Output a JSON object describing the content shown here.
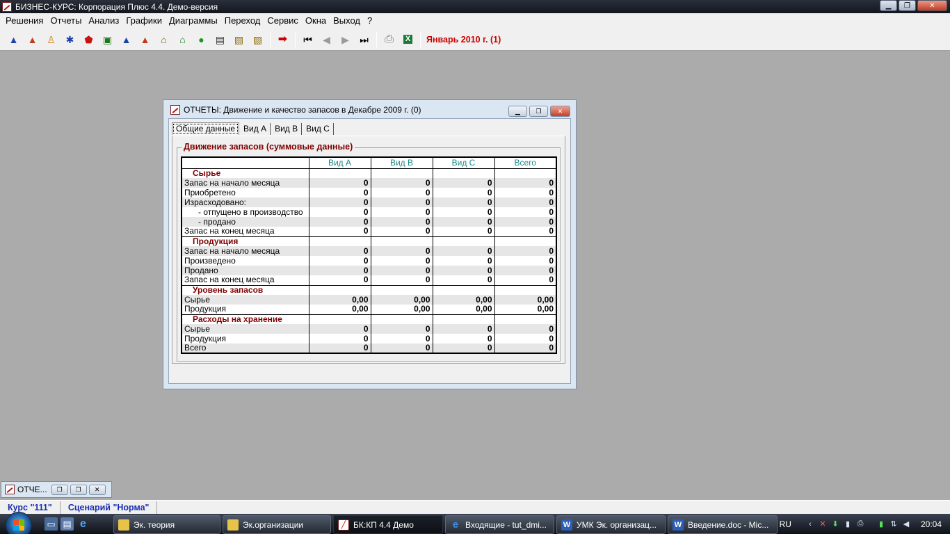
{
  "app": {
    "title": "БИЗНЕС-КУРС: Корпорация Плюс 4.4. Демо-версия",
    "minimize": "▁",
    "restore": "❐",
    "close": "✕"
  },
  "menu": [
    "Решения",
    "Отчеты",
    "Анализ",
    "Графики",
    "Диаграммы",
    "Переход",
    "Сервис",
    "Окна",
    "Выход",
    "?"
  ],
  "toolbar": {
    "icons_left": [
      {
        "name": "plan-icon",
        "glyph": "▲",
        "color": "#1c3fa8"
      },
      {
        "name": "marketing-icon",
        "glyph": "▲",
        "color": "#c23a1a"
      },
      {
        "name": "personnel-icon",
        "glyph": "♙",
        "color": "#d07a00"
      },
      {
        "name": "staff-icon",
        "glyph": "✱",
        "color": "#1c3fa8"
      },
      {
        "name": "production-icon",
        "glyph": "⬟",
        "color": "#cc1111"
      },
      {
        "name": "supply-icon",
        "glyph": "▣",
        "color": "#1a7a1a"
      },
      {
        "name": "sales-icon",
        "glyph": "▲",
        "color": "#1c3fa8"
      },
      {
        "name": "finance-icon",
        "glyph": "▲",
        "color": "#c23a1a"
      },
      {
        "name": "bank-icon",
        "glyph": "⌂",
        "color": "#7a5a10"
      },
      {
        "name": "credit-icon",
        "glyph": "⌂",
        "color": "#1a7a1a"
      },
      {
        "name": "money-bag-icon",
        "glyph": "●",
        "color": "#1a9a1a"
      },
      {
        "name": "document-icon",
        "glyph": "▤",
        "color": "#333333"
      },
      {
        "name": "report-icon",
        "glyph": "▧",
        "color": "#8a6a10"
      },
      {
        "name": "journal-icon",
        "glyph": "▨",
        "color": "#8a6a10"
      }
    ],
    "next_step": {
      "name": "next-step-icon",
      "glyph": "➡",
      "color": "#cc0000"
    },
    "nav": [
      {
        "name": "first-period-icon",
        "glyph": "⏮",
        "disabled": false
      },
      {
        "name": "prev-period-icon",
        "glyph": "◀",
        "disabled": true
      },
      {
        "name": "next-period-icon",
        "glyph": "▶",
        "disabled": true
      },
      {
        "name": "last-period-icon",
        "glyph": "⏭",
        "disabled": false
      }
    ],
    "print": {
      "name": "print-icon",
      "glyph": "⎙"
    },
    "excel": {
      "name": "excel-icon",
      "glyph": "X"
    },
    "period": "Январь 2010 г. (1)"
  },
  "report": {
    "title": "ОТЧЕТЫ: Движение и качество запасов в Декабре 2009 г. (0)",
    "tabs": [
      "Общие данные",
      "Вид А",
      "Вид В",
      "Вид С"
    ],
    "group_title": "Движение запасов (суммовые данные)",
    "columns": [
      "Вид А",
      "Вид В",
      "Вид С",
      "Всего"
    ],
    "sections": [
      {
        "title": "Сырье",
        "rows": [
          {
            "label": "Запас на начало месяца",
            "indent": false,
            "values": [
              "0",
              "0",
              "0",
              "0"
            ]
          },
          {
            "label": "Приобретено",
            "indent": false,
            "values": [
              "0",
              "0",
              "0",
              "0"
            ]
          },
          {
            "label": "Израсходовано:",
            "indent": false,
            "values": [
              "0",
              "0",
              "0",
              "0"
            ]
          },
          {
            "label": "- отпущено в производство",
            "indent": true,
            "values": [
              "0",
              "0",
              "0",
              "0"
            ]
          },
          {
            "label": "- продано",
            "indent": true,
            "values": [
              "0",
              "0",
              "0",
              "0"
            ]
          },
          {
            "label": "Запас на конец месяца",
            "indent": false,
            "values": [
              "0",
              "0",
              "0",
              "0"
            ]
          }
        ]
      },
      {
        "title": "Продукция",
        "rows": [
          {
            "label": "Запас на начало месяца",
            "indent": false,
            "values": [
              "0",
              "0",
              "0",
              "0"
            ]
          },
          {
            "label": "Произведено",
            "indent": false,
            "values": [
              "0",
              "0",
              "0",
              "0"
            ]
          },
          {
            "label": "Продано",
            "indent": false,
            "values": [
              "0",
              "0",
              "0",
              "0"
            ]
          },
          {
            "label": "Запас на конец месяца",
            "indent": false,
            "values": [
              "0",
              "0",
              "0",
              "0"
            ]
          }
        ]
      },
      {
        "title": "Уровень запасов",
        "rows": [
          {
            "label": "Сырье",
            "indent": false,
            "values": [
              "0,00",
              "0,00",
              "0,00",
              "0,00"
            ]
          },
          {
            "label": "Продукция",
            "indent": false,
            "values": [
              "0,00",
              "0,00",
              "0,00",
              "0,00"
            ]
          }
        ]
      },
      {
        "title": "Расходы на хранение",
        "rows": [
          {
            "label": "Сырье",
            "indent": false,
            "values": [
              "0",
              "0",
              "0",
              "0"
            ]
          },
          {
            "label": "Продукция",
            "indent": false,
            "values": [
              "0",
              "0",
              "0",
              "0"
            ]
          },
          {
            "label": "Всего",
            "indent": false,
            "values": [
              "0",
              "0",
              "0",
              "0"
            ]
          }
        ]
      }
    ]
  },
  "minimized_window": {
    "title": "ОТЧЕ..."
  },
  "status": {
    "course": "Курс \"111\"",
    "scenario": "Сценарий \"Норма\""
  },
  "taskbar": {
    "tasks": [
      {
        "label": "Эк. теория",
        "icon": "folder",
        "color": "#e8c34a"
      },
      {
        "label": "Эк.организации",
        "icon": "folder",
        "color": "#e8c34a"
      },
      {
        "label": "БК:КП 4.4 Демо",
        "icon": "app",
        "color": "#ffffff",
        "active": true
      },
      {
        "label": "Входящие - tut_dmi...",
        "icon": "ie",
        "color": "#3a8ee8"
      },
      {
        "label": "УМК Эк. организац...",
        "icon": "word",
        "color": "#2b5fb8"
      },
      {
        "label": "Введение.doc - Mic...",
        "icon": "word",
        "color": "#2b5fb8"
      }
    ],
    "lang": "RU",
    "clock": "20:04"
  }
}
